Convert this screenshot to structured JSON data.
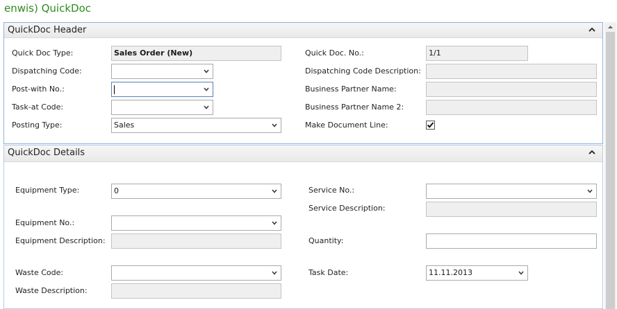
{
  "window": {
    "title": "enwis) QuickDoc"
  },
  "header_panel": {
    "title": "QuickDoc Header",
    "quick_doc_type": {
      "label": "Quick Doc Type:",
      "value": "Sales Order (New)"
    },
    "dispatching_code": {
      "label": "Dispatching Code:",
      "value": ""
    },
    "post_with_no": {
      "label": "Post-with No.:",
      "value": ""
    },
    "task_at_code": {
      "label": "Task-at Code:",
      "value": ""
    },
    "posting_type": {
      "label": "Posting Type:",
      "value": "Sales"
    },
    "quick_doc_no": {
      "label": "Quick Doc. No.:",
      "value": "1/1"
    },
    "dispatching_code_description": {
      "label": "Dispatching Code Description:",
      "value": ""
    },
    "business_partner_name": {
      "label": "Business Partner Name:",
      "value": ""
    },
    "business_partner_name_2": {
      "label": "Business Partner Name 2:",
      "value": ""
    },
    "make_document_line": {
      "label": "Make Document Line:",
      "checked": true
    }
  },
  "details_panel": {
    "title": "QuickDoc Details",
    "equipment_type": {
      "label": "Equipment Type:",
      "value": "0"
    },
    "equipment_no": {
      "label": "Equipment No.:",
      "value": ""
    },
    "equipment_description": {
      "label": "Equipment Description:",
      "value": ""
    },
    "waste_code": {
      "label": "Waste Code:",
      "value": ""
    },
    "waste_description": {
      "label": "Waste Description:",
      "value": ""
    },
    "service_no": {
      "label": "Service No.:",
      "value": ""
    },
    "service_description": {
      "label": "Service Description:",
      "value": ""
    },
    "quantity": {
      "label": "Quantity:",
      "value": ""
    },
    "task_date": {
      "label": "Task Date:",
      "value": "11.11.2013"
    }
  },
  "icons": {
    "collapse": "chevron-up-icon",
    "dropdown": "chevron-down-icon",
    "check": "check-icon",
    "scroll_up": "scroll-up-arrow-icon"
  },
  "colors": {
    "title_green": "#2e8b1f",
    "panel_border": "#8fb0de",
    "readonly_bg": "#efefef"
  }
}
